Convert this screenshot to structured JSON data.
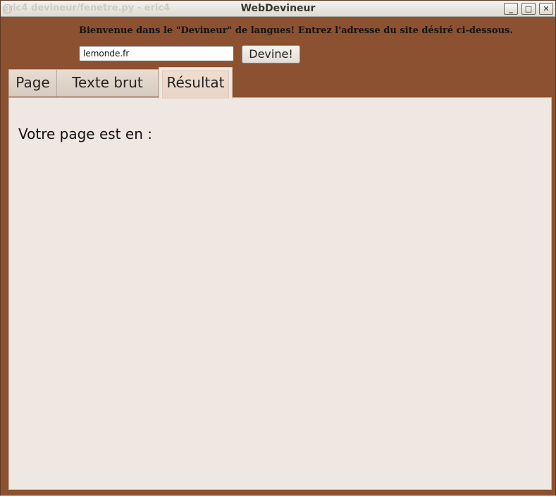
{
  "window": {
    "title": "WebDevineur",
    "background_title": "eric4 devineur/fenetre.py - eric4",
    "controls": {
      "minimize": "_",
      "maximize": "□",
      "close": "✕"
    },
    "accent_color": "#8b5130"
  },
  "header": {
    "welcome": "Bienvenue dans le \"Devineur\" de langues! Entrez l'adresse du site désiré ci-dessous.",
    "url_value": "lemonde.fr",
    "guess_label": "Devine!"
  },
  "tabs": [
    {
      "label": "Page",
      "active": false
    },
    {
      "label": "Texte brut",
      "active": false
    },
    {
      "label": "Résultat",
      "active": true
    }
  ],
  "result": {
    "label": "Votre page est en :"
  }
}
